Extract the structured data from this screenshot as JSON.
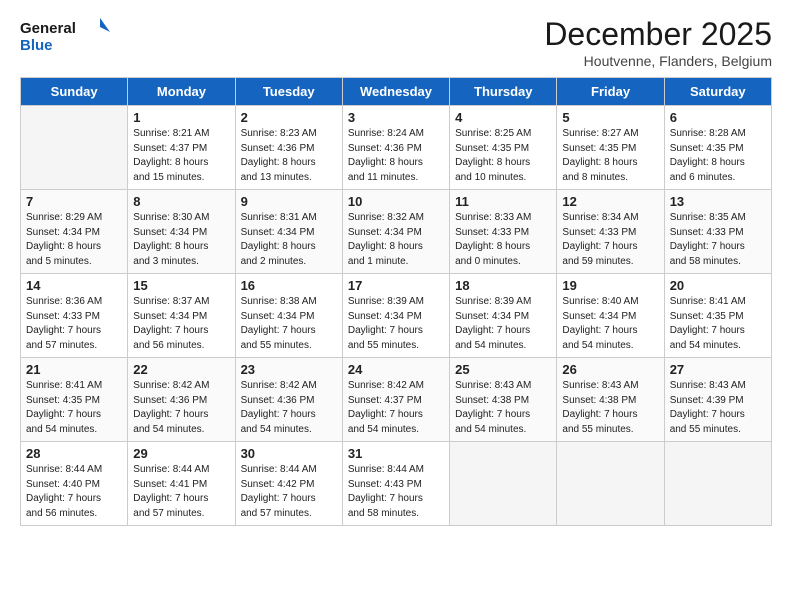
{
  "header": {
    "logo_line1": "General",
    "logo_line2": "Blue",
    "month": "December 2025",
    "location": "Houtvenne, Flanders, Belgium"
  },
  "weekdays": [
    "Sunday",
    "Monday",
    "Tuesday",
    "Wednesday",
    "Thursday",
    "Friday",
    "Saturday"
  ],
  "weeks": [
    [
      {
        "day": "",
        "info": ""
      },
      {
        "day": "1",
        "info": "Sunrise: 8:21 AM\nSunset: 4:37 PM\nDaylight: 8 hours\nand 15 minutes."
      },
      {
        "day": "2",
        "info": "Sunrise: 8:23 AM\nSunset: 4:36 PM\nDaylight: 8 hours\nand 13 minutes."
      },
      {
        "day": "3",
        "info": "Sunrise: 8:24 AM\nSunset: 4:36 PM\nDaylight: 8 hours\nand 11 minutes."
      },
      {
        "day": "4",
        "info": "Sunrise: 8:25 AM\nSunset: 4:35 PM\nDaylight: 8 hours\nand 10 minutes."
      },
      {
        "day": "5",
        "info": "Sunrise: 8:27 AM\nSunset: 4:35 PM\nDaylight: 8 hours\nand 8 minutes."
      },
      {
        "day": "6",
        "info": "Sunrise: 8:28 AM\nSunset: 4:35 PM\nDaylight: 8 hours\nand 6 minutes."
      }
    ],
    [
      {
        "day": "7",
        "info": "Sunrise: 8:29 AM\nSunset: 4:34 PM\nDaylight: 8 hours\nand 5 minutes."
      },
      {
        "day": "8",
        "info": "Sunrise: 8:30 AM\nSunset: 4:34 PM\nDaylight: 8 hours\nand 3 minutes."
      },
      {
        "day": "9",
        "info": "Sunrise: 8:31 AM\nSunset: 4:34 PM\nDaylight: 8 hours\nand 2 minutes."
      },
      {
        "day": "10",
        "info": "Sunrise: 8:32 AM\nSunset: 4:34 PM\nDaylight: 8 hours\nand 1 minute."
      },
      {
        "day": "11",
        "info": "Sunrise: 8:33 AM\nSunset: 4:33 PM\nDaylight: 8 hours\nand 0 minutes."
      },
      {
        "day": "12",
        "info": "Sunrise: 8:34 AM\nSunset: 4:33 PM\nDaylight: 7 hours\nand 59 minutes."
      },
      {
        "day": "13",
        "info": "Sunrise: 8:35 AM\nSunset: 4:33 PM\nDaylight: 7 hours\nand 58 minutes."
      }
    ],
    [
      {
        "day": "14",
        "info": "Sunrise: 8:36 AM\nSunset: 4:33 PM\nDaylight: 7 hours\nand 57 minutes."
      },
      {
        "day": "15",
        "info": "Sunrise: 8:37 AM\nSunset: 4:34 PM\nDaylight: 7 hours\nand 56 minutes."
      },
      {
        "day": "16",
        "info": "Sunrise: 8:38 AM\nSunset: 4:34 PM\nDaylight: 7 hours\nand 55 minutes."
      },
      {
        "day": "17",
        "info": "Sunrise: 8:39 AM\nSunset: 4:34 PM\nDaylight: 7 hours\nand 55 minutes."
      },
      {
        "day": "18",
        "info": "Sunrise: 8:39 AM\nSunset: 4:34 PM\nDaylight: 7 hours\nand 54 minutes."
      },
      {
        "day": "19",
        "info": "Sunrise: 8:40 AM\nSunset: 4:34 PM\nDaylight: 7 hours\nand 54 minutes."
      },
      {
        "day": "20",
        "info": "Sunrise: 8:41 AM\nSunset: 4:35 PM\nDaylight: 7 hours\nand 54 minutes."
      }
    ],
    [
      {
        "day": "21",
        "info": "Sunrise: 8:41 AM\nSunset: 4:35 PM\nDaylight: 7 hours\nand 54 minutes."
      },
      {
        "day": "22",
        "info": "Sunrise: 8:42 AM\nSunset: 4:36 PM\nDaylight: 7 hours\nand 54 minutes."
      },
      {
        "day": "23",
        "info": "Sunrise: 8:42 AM\nSunset: 4:36 PM\nDaylight: 7 hours\nand 54 minutes."
      },
      {
        "day": "24",
        "info": "Sunrise: 8:42 AM\nSunset: 4:37 PM\nDaylight: 7 hours\nand 54 minutes."
      },
      {
        "day": "25",
        "info": "Sunrise: 8:43 AM\nSunset: 4:38 PM\nDaylight: 7 hours\nand 54 minutes."
      },
      {
        "day": "26",
        "info": "Sunrise: 8:43 AM\nSunset: 4:38 PM\nDaylight: 7 hours\nand 55 minutes."
      },
      {
        "day": "27",
        "info": "Sunrise: 8:43 AM\nSunset: 4:39 PM\nDaylight: 7 hours\nand 55 minutes."
      }
    ],
    [
      {
        "day": "28",
        "info": "Sunrise: 8:44 AM\nSunset: 4:40 PM\nDaylight: 7 hours\nand 56 minutes."
      },
      {
        "day": "29",
        "info": "Sunrise: 8:44 AM\nSunset: 4:41 PM\nDaylight: 7 hours\nand 57 minutes."
      },
      {
        "day": "30",
        "info": "Sunrise: 8:44 AM\nSunset: 4:42 PM\nDaylight: 7 hours\nand 57 minutes."
      },
      {
        "day": "31",
        "info": "Sunrise: 8:44 AM\nSunset: 4:43 PM\nDaylight: 7 hours\nand 58 minutes."
      },
      {
        "day": "",
        "info": ""
      },
      {
        "day": "",
        "info": ""
      },
      {
        "day": "",
        "info": ""
      }
    ]
  ]
}
